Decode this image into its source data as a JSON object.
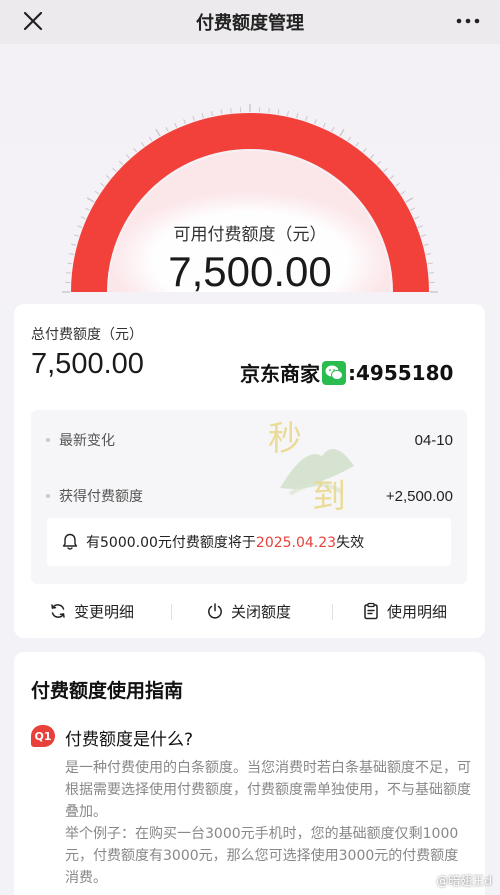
{
  "nav": {
    "title": "付费额度管理",
    "close_icon": "close-icon",
    "more_icon": "more-icon"
  },
  "gauge": {
    "label": "可用付费额度（元）",
    "amount": "7,500.00",
    "used_fraction": 1.0,
    "arc_color": "#f2403a"
  },
  "summary": {
    "total_label": "总付费额度（元）",
    "total_amount": "7,500.00",
    "overlay_text_left": "京东商家",
    "overlay_text_right": ":4955180",
    "overlay_icon": "wechat-icon",
    "rows": [
      {
        "label": "最新变化",
        "value": "04-10"
      },
      {
        "label": "获得付费额度",
        "value": "+2,500.00"
      }
    ],
    "notice_prefix": "有5000.00元付费额度将于",
    "notice_date": "2025.04.23",
    "notice_suffix": "失效",
    "notice_icon": "bell-icon",
    "deco_text": "秒到"
  },
  "actions": [
    {
      "label": "变更明细",
      "icon": "refresh-icon"
    },
    {
      "label": "关闭额度",
      "icon": "power-icon"
    },
    {
      "label": "使用明细",
      "icon": "clipboard-icon"
    }
  ],
  "guide": {
    "title": "付费额度使用指南",
    "q_badge": "Q1",
    "q_title": "付费额度是什么?",
    "answer_lines": [
      "是一种付费使用的白条额度。当您消费时若白条基础额度不足，可根据需要选择使用付费额度，付费额度需单独使用，不与基础额度叠加。",
      "举个例子：在购买一台3000元手机时，您的基础额度仅剩1000元，付费额度有3000元，那么您可选择使用3000元的付费额度消费。"
    ]
  },
  "watermark": "@暗翅王d",
  "colors": {
    "accent_red": "#e8413b",
    "card_bg": "#ffffff",
    "page_bg": "#f3f2f6"
  }
}
